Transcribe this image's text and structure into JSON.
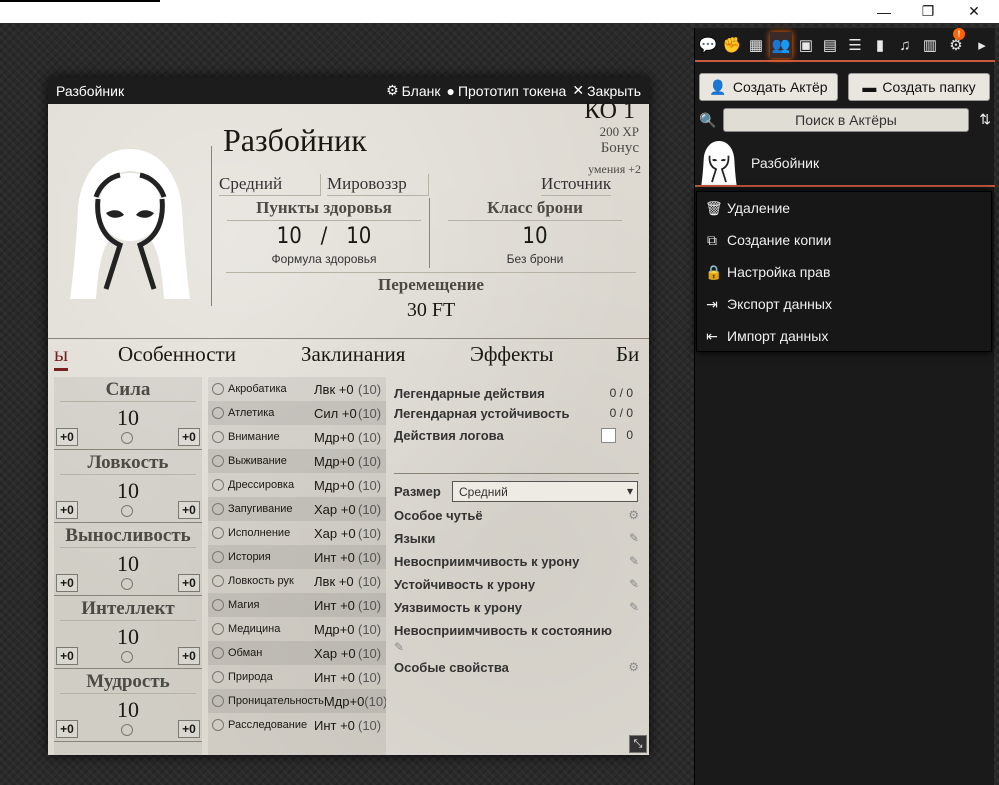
{
  "window": {
    "min": "—",
    "max": "❐",
    "close": "✕"
  },
  "sheet": {
    "header_title": "Разбойник",
    "blank_label": "Бланк",
    "token_label": "Прототип токена",
    "close_label": "Закрыть",
    "name": "Разбойник",
    "cr": "КО 1",
    "xp": "200 XP",
    "bonus": "Бонус",
    "bonus2": "умения +2",
    "size": "Средний",
    "alignment": "Мировоззр",
    "source": "Источник",
    "hp_title": "Пункты здоровья",
    "hp_value": "10",
    "hp_sep": "/",
    "hp_max": "10",
    "hp_formula": "Формула здоровья",
    "ac_title": "Класс брони",
    "ac_value": "10",
    "ac_sub": "Без брони",
    "move_title": "Перемещение",
    "move_value": "30 FT",
    "tabs": [
      "ы",
      "Особенности",
      "Заклинания",
      "Эффекты",
      "Би"
    ],
    "abilities": [
      {
        "name": "Сила",
        "value": "10",
        "mod": "+0",
        "save": "+0"
      },
      {
        "name": "Ловкость",
        "value": "10",
        "mod": "+0",
        "save": "+0"
      },
      {
        "name": "Выносливость",
        "value": "10",
        "mod": "+0",
        "save": "+0"
      },
      {
        "name": "Интеллект",
        "value": "10",
        "mod": "+0",
        "save": "+0"
      },
      {
        "name": "Мудрость",
        "value": "10",
        "mod": "+0",
        "save": "+0"
      }
    ],
    "skills": [
      {
        "name": "Акробатика",
        "abil": "Лвк +0",
        "pass": "(10)"
      },
      {
        "name": "Атлетика",
        "abil": "Сил +0",
        "pass": "(10)"
      },
      {
        "name": "Внимание",
        "abil": "Мдр+0",
        "pass": "(10)"
      },
      {
        "name": "Выживание",
        "abil": "Мдр+0",
        "pass": "(10)"
      },
      {
        "name": "Дрессировка",
        "abil": "Мдр+0",
        "pass": "(10)"
      },
      {
        "name": "Запугивание",
        "abil": "Хар +0",
        "pass": "(10)"
      },
      {
        "name": "Исполнение",
        "abil": "Хар +0",
        "pass": "(10)"
      },
      {
        "name": "История",
        "abil": "Инт +0",
        "pass": "(10)"
      },
      {
        "name": "Ловкость рук",
        "abil": "Лвк +0",
        "pass": "(10)"
      },
      {
        "name": "Магия",
        "abil": "Инт +0",
        "pass": "(10)"
      },
      {
        "name": "Медицина",
        "abil": "Мдр+0",
        "pass": "(10)"
      },
      {
        "name": "Обман",
        "abil": "Хар +0",
        "pass": "(10)"
      },
      {
        "name": "Природа",
        "abil": "Инт +0",
        "pass": "(10)"
      },
      {
        "name": "Проницательность",
        "abil": "Мдр+0",
        "pass": "(10)"
      },
      {
        "name": "Расследование",
        "abil": "Инт +0",
        "pass": "(10)"
      }
    ],
    "traits": {
      "leg_actions": "Легендарные действия",
      "leg_actions_val": "0 / 0",
      "leg_res": "Легендарная устойчивость",
      "leg_res_val": "0 / 0",
      "lair": "Действия логова",
      "lair_val": "0",
      "size_label": "Размер",
      "size_value": "Средний",
      "senses": "Особое чутьё",
      "languages": "Языки",
      "dmg_immune": "Невосприимчивость к урону",
      "dmg_resist": "Устойчивость к урону",
      "dmg_vuln": "Уязвимость к урону",
      "cond_immune": "Невосприимчивость к состоянию",
      "special": "Особые свойства"
    }
  },
  "sidebar": {
    "create_actor": "Создать Актёр",
    "create_folder": "Создать папку",
    "search_placeholder": "Поиск в Актёры",
    "badge": "!",
    "actor_name": "Разбойник",
    "context_menu": [
      "Удаление",
      "Создание копии",
      "Настройка прав",
      "Экспорт данных",
      "Импорт данных"
    ]
  },
  "colors": {
    "accent": "#c9593f",
    "sheet_bg": "#dedad2",
    "header_bg": "#1c1c1c",
    "active_tab": "#7a1f1f"
  }
}
